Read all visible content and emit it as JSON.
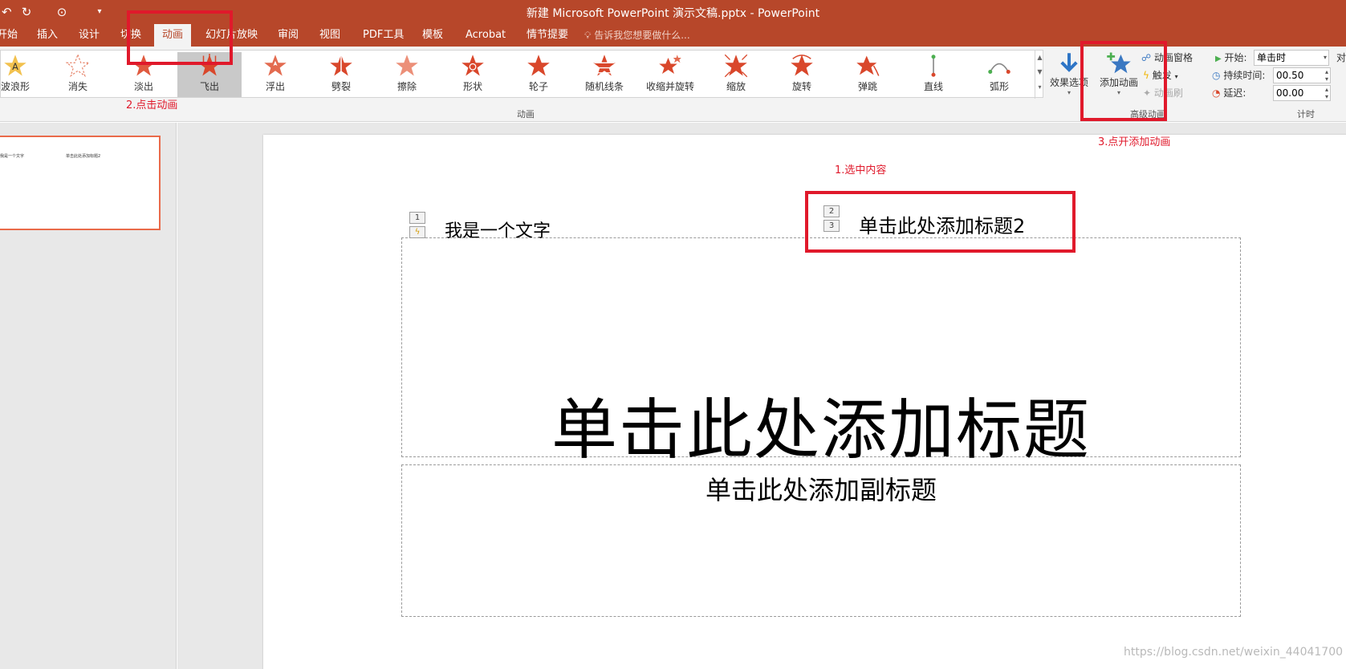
{
  "window": {
    "title": "新建 Microsoft PowerPoint 演示文稿.pptx - PowerPoint",
    "qat": {
      "undo": "↶",
      "redo": "↻",
      "slideshow": "⊙",
      "customize": "▾"
    }
  },
  "tabs": [
    {
      "label": "开始"
    },
    {
      "label": "插入"
    },
    {
      "label": "设计"
    },
    {
      "label": "切换"
    },
    {
      "label": "动画",
      "active": true
    },
    {
      "label": "幻灯片放映"
    },
    {
      "label": "审阅"
    },
    {
      "label": "视图"
    },
    {
      "label": "PDF工具"
    },
    {
      "label": "模板"
    },
    {
      "label": "Acrobat"
    },
    {
      "label": "情节提要"
    }
  ],
  "tell_me": "告诉我您想要做什么...",
  "ribbon": {
    "gallery": [
      {
        "label": "波浪形",
        "icon": "wave-star-icon"
      },
      {
        "label": "消失",
        "icon": "disappear-star-icon"
      },
      {
        "label": "淡出",
        "icon": "fade-star-icon"
      },
      {
        "label": "飞出",
        "icon": "fly-out-star-icon",
        "selected": true
      },
      {
        "label": "浮出",
        "icon": "float-out-star-icon"
      },
      {
        "label": "劈裂",
        "icon": "split-star-icon"
      },
      {
        "label": "擦除",
        "icon": "wipe-star-icon"
      },
      {
        "label": "形状",
        "icon": "shape-star-icon"
      },
      {
        "label": "轮子",
        "icon": "wheel-star-icon"
      },
      {
        "label": "随机线条",
        "icon": "random-bars-star-icon"
      },
      {
        "label": "收缩并旋转",
        "icon": "shrink-turn-star-icon"
      },
      {
        "label": "缩放",
        "icon": "zoom-star-icon"
      },
      {
        "label": "旋转",
        "icon": "swivel-star-icon"
      },
      {
        "label": "弹跳",
        "icon": "bounce-star-icon"
      },
      {
        "label": "直线",
        "icon": "lines-path-icon"
      },
      {
        "label": "弧形",
        "icon": "arcs-path-icon"
      }
    ],
    "effect_options": "效果选项",
    "animation_group": "动画",
    "add_animation": "添加动画",
    "animation_pane": "动画窗格",
    "trigger": "触发",
    "animation_painter": "动画刷",
    "advanced_group": "高级动画",
    "start_label": "开始:",
    "start_value": "单击时",
    "duration_label": "持续时间:",
    "duration_value": "00.50",
    "delay_label": "延迟:",
    "delay_value": "00.00",
    "timing_group": "计时",
    "reorder_label": "对"
  },
  "thumbnail": {
    "text1": "我是一个文字",
    "text2": "单击此处添加标题2"
  },
  "slide": {
    "text_box": "我是一个文字",
    "title2": "单击此处添加标题2",
    "title": "单击此处添加标题",
    "subtitle": "单击此处添加副标题",
    "tags": {
      "t1": "1",
      "t2": "2",
      "t3": "3",
      "lightning": "ϟ"
    }
  },
  "annotations": {
    "step1": "1.选中内容",
    "step2": "2.点击动画",
    "step3": "3.点开添加动画"
  },
  "watermark": "https://blog.csdn.net/weixin_44041700",
  "colors": {
    "accent": "#b7472a",
    "star": "#d9472b",
    "highlight": "#e0192b"
  }
}
